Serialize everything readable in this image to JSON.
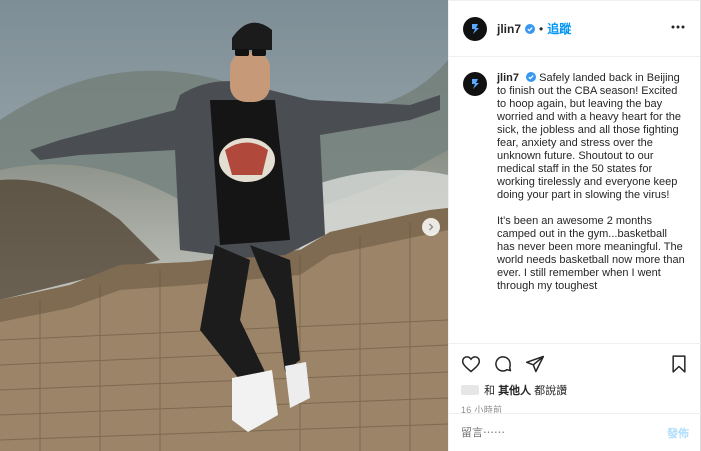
{
  "post": {
    "username": "jlin7",
    "follow_label": "追蹤",
    "dot": "•",
    "icons": {
      "avatar": "avatar-logo",
      "verified": "verified-badge-icon",
      "more": "more-options-icon",
      "next": "next-photo-arrow-icon",
      "like": "heart-icon",
      "comment": "comment-icon",
      "share": "share-icon",
      "save": "bookmark-icon"
    },
    "colors": {
      "link": "#0095f6",
      "verified": "#3897f0",
      "post_disabled": "#b2dffc"
    }
  },
  "caption": {
    "username": "jlin7",
    "paragraphs": [
      "Safely landed back in Beijing to finish out the CBA season! Excited to hoop again, but leaving the bay worried and with a heavy heart for the sick, the jobless and all those fighting fear, anxiety and stress over the unknown future. Shoutout to our medical staff in the 50 states for working tirelessly and everyone keep doing your part in slowing the virus!",
      "It's been an awesome 2 months camped out in the gym...basketball has never been more meaningful. The world needs basketball now more than ever. I still remember when I went through my toughest"
    ]
  },
  "engagement": {
    "likes_prefix": "和",
    "likes_bold": "其他人",
    "likes_suffix": "都說讚",
    "timestamp": "16 小時前"
  },
  "comment": {
    "placeholder": "留言⋯⋯",
    "post_label": "發佈"
  }
}
